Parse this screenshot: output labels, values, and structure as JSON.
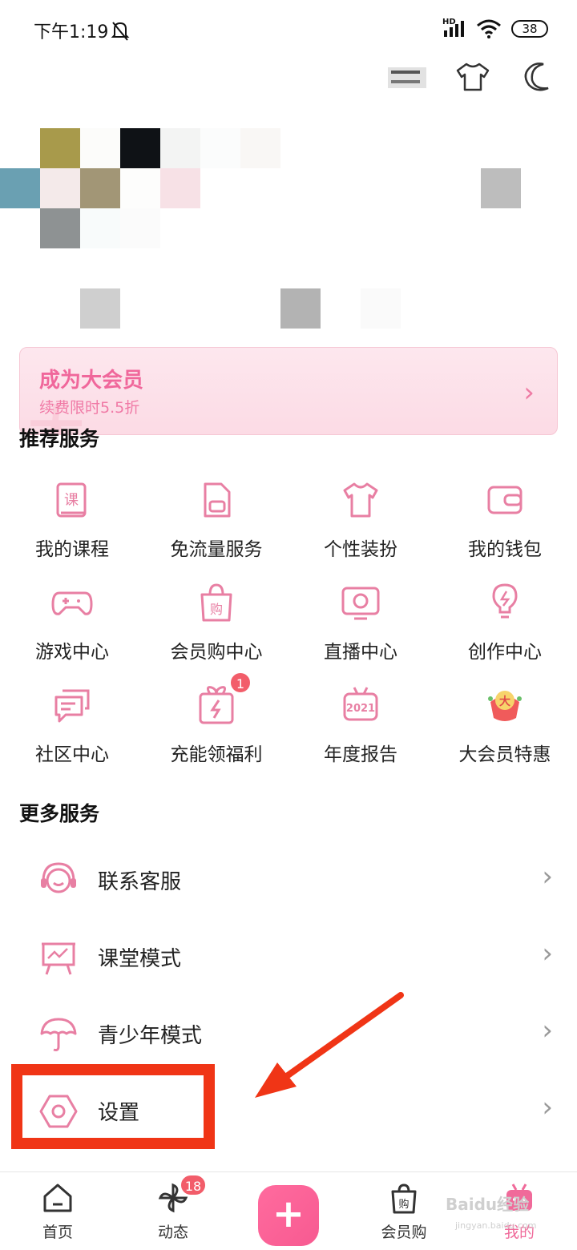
{
  "status_bar": {
    "time": "下午1:19",
    "network": "HD",
    "battery": "38"
  },
  "vip": {
    "title": "成为大会员",
    "subtitle": "续费限时5.5折"
  },
  "recommended": {
    "title": "推荐服务",
    "items": [
      {
        "label": "我的课程",
        "icon": "course-book-icon"
      },
      {
        "label": "免流量服务",
        "icon": "sim-card-icon"
      },
      {
        "label": "个性装扮",
        "icon": "tshirt-icon"
      },
      {
        "label": "我的钱包",
        "icon": "wallet-icon"
      },
      {
        "label": "游戏中心",
        "icon": "gamepad-icon"
      },
      {
        "label": "会员购中心",
        "icon": "shopping-bag-icon"
      },
      {
        "label": "直播中心",
        "icon": "live-tv-icon"
      },
      {
        "label": "创作中心",
        "icon": "lightbulb-icon"
      },
      {
        "label": "社区中心",
        "icon": "chat-bubbles-icon"
      },
      {
        "label": "充能领福利",
        "icon": "gift-charge-icon",
        "badge": "1"
      },
      {
        "label": "年度报告",
        "icon": "annual-report-icon",
        "year": "2021"
      },
      {
        "label": "大会员特惠",
        "icon": "vip-special-icon"
      }
    ]
  },
  "more": {
    "title": "更多服务",
    "items": [
      {
        "label": "联系客服",
        "icon": "headset-icon"
      },
      {
        "label": "课堂模式",
        "icon": "classroom-icon"
      },
      {
        "label": "青少年模式",
        "icon": "umbrella-icon"
      },
      {
        "label": "设置",
        "icon": "settings-hexagon-icon"
      }
    ]
  },
  "bottom_nav": {
    "items": [
      {
        "label": "首页",
        "icon": "home-icon"
      },
      {
        "label": "动态",
        "icon": "pinwheel-icon",
        "badge": "18"
      },
      {
        "label": "会员购",
        "icon": "shopping-bag-icon"
      },
      {
        "label": "我的",
        "icon": "tv-mascot-icon"
      }
    ],
    "plus": "+"
  },
  "watermark": {
    "text": "Baidu经验",
    "url": "jingyan.baidu.com"
  },
  "colors": {
    "accent": "#f06a9a",
    "highlight": "#f03516"
  }
}
